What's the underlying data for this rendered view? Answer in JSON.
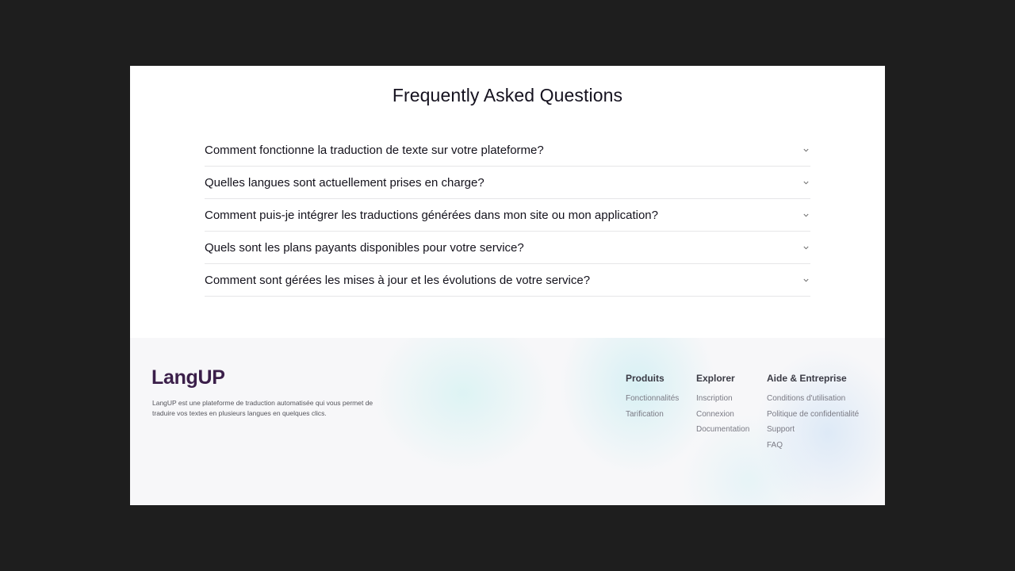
{
  "faq": {
    "title": "Frequently Asked Questions",
    "items": [
      {
        "question": "Comment fonctionne la traduction de texte sur votre plateforme?"
      },
      {
        "question": "Quelles langues sont actuellement prises en charge?"
      },
      {
        "question": "Comment puis-je intégrer les traductions générées dans mon site ou mon application?"
      },
      {
        "question": "Quels sont les plans payants disponibles pour votre service?"
      },
      {
        "question": "Comment sont gérées les mises à jour et les évolutions de votre service?"
      }
    ],
    "icon": "chevron-down-icon"
  },
  "footer": {
    "brand": "LangUP",
    "brand_color": "#3b1f4a",
    "description": "LangUP est une plateforme de traduction automatisée qui vous permet de traduire vos textes en plusieurs langues en quelques clics.",
    "columns": [
      {
        "title": "Produits",
        "links": [
          "Fonctionnalités",
          "Tarification"
        ]
      },
      {
        "title": "Explorer",
        "links": [
          "Inscription",
          "Connexion",
          "Documentation"
        ]
      },
      {
        "title": "Aide & Entreprise",
        "links": [
          "Conditions d'utilisation",
          "Politique de confidentialité",
          "Support",
          "FAQ"
        ]
      }
    ]
  }
}
